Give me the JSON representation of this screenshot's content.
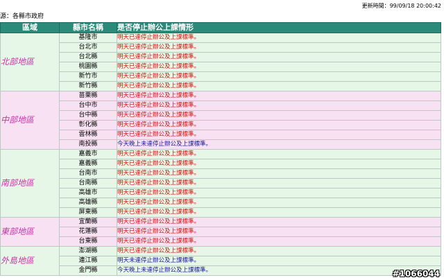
{
  "header": {
    "update_time": "更新時間：99/09/18 20:00:42",
    "source": "源：各縣市政府"
  },
  "table": {
    "headers": [
      "區域",
      "縣市名稱",
      "是否停止辦公上課情形"
    ],
    "groups": [
      {
        "region": "北部地區",
        "theme": "green",
        "rows": [
          {
            "county": "基隆市",
            "status": "明天已達停止辦公及上課標準。",
            "color": "red"
          },
          {
            "county": "台北市",
            "status": "明天已達停止辦公及上課標準。",
            "color": "red"
          },
          {
            "county": "台北縣",
            "status": "明天已達停止辦公及上課標準。",
            "color": "red"
          },
          {
            "county": "桃園縣",
            "status": "明天已達停止辦公及上課標準。",
            "color": "red"
          },
          {
            "county": "新竹市",
            "status": "明天已達停止辦公及上課標準。",
            "color": "red"
          },
          {
            "county": "新竹縣",
            "status": "明天已達停止辦公及上課標準。",
            "color": "red"
          }
        ]
      },
      {
        "region": "中部地區",
        "theme": "pink",
        "rows": [
          {
            "county": "苗栗縣",
            "status": "明天已達停止辦公及上課標準。",
            "color": "red"
          },
          {
            "county": "台中市",
            "status": "明天已達停止辦公及上課標準。",
            "color": "red"
          },
          {
            "county": "台中縣",
            "status": "明天已達停止辦公及上課標準。",
            "color": "red"
          },
          {
            "county": "彰化縣",
            "status": "明天已達停止辦公及上課標準。",
            "color": "red"
          },
          {
            "county": "雲林縣",
            "status": "明天已達停止辦公及上課標準。",
            "color": "red"
          },
          {
            "county": "南投縣",
            "status": "今天晚上未達停止辦公及上課標準。",
            "color": "blue"
          }
        ]
      },
      {
        "region": "南部地區",
        "theme": "green",
        "rows": [
          {
            "county": "嘉義市",
            "status": "明天已達停止辦公及上課標準。",
            "color": "red"
          },
          {
            "county": "嘉義縣",
            "status": "明天已達停止辦公及上課標準。",
            "color": "red"
          },
          {
            "county": "台南市",
            "status": "明天已達停止辦公及上課標準。",
            "color": "red"
          },
          {
            "county": "台南縣",
            "status": "明天已達停止辦公及上課標準。",
            "color": "red"
          },
          {
            "county": "高雄市",
            "status": "明天已達停止辦公及上課標準。",
            "color": "red"
          },
          {
            "county": "高雄縣",
            "status": "明天已達停止辦公及上課標準。",
            "color": "red"
          },
          {
            "county": "屏東縣",
            "status": "明天已達停止辦公及上課標準。",
            "color": "red"
          }
        ]
      },
      {
        "region": "東部地區",
        "theme": "pink",
        "rows": [
          {
            "county": "宜蘭縣",
            "status": "明天已達停止辦公及上課標準。",
            "color": "red"
          },
          {
            "county": "花蓮縣",
            "status": "明天已達停止辦公及上課標準。",
            "color": "red"
          },
          {
            "county": "台東縣",
            "status": "明天已達停止辦公及上課標準。",
            "color": "red"
          }
        ]
      },
      {
        "region": "外島地區",
        "theme": "green",
        "rows": [
          {
            "county": "澎湖縣",
            "status": "明天已達停止辦公及上課標準。",
            "color": "red"
          },
          {
            "county": "連江縣",
            "status": "明天未達停止辦公及上課標準。",
            "color": "blue"
          },
          {
            "county": "金門縣",
            "status": "今天晚上未達停止辦公及上課標準。",
            "color": "blue"
          }
        ]
      }
    ]
  },
  "watermark": "#1066044",
  "colors": {
    "header_bg": "#2b8a7a",
    "green_row": "#e6f6e7",
    "pink_row": "#f7e1f3",
    "region_text": "#cc33aa",
    "red_status": "#d4150f",
    "blue_status": "#1a1a9a"
  }
}
